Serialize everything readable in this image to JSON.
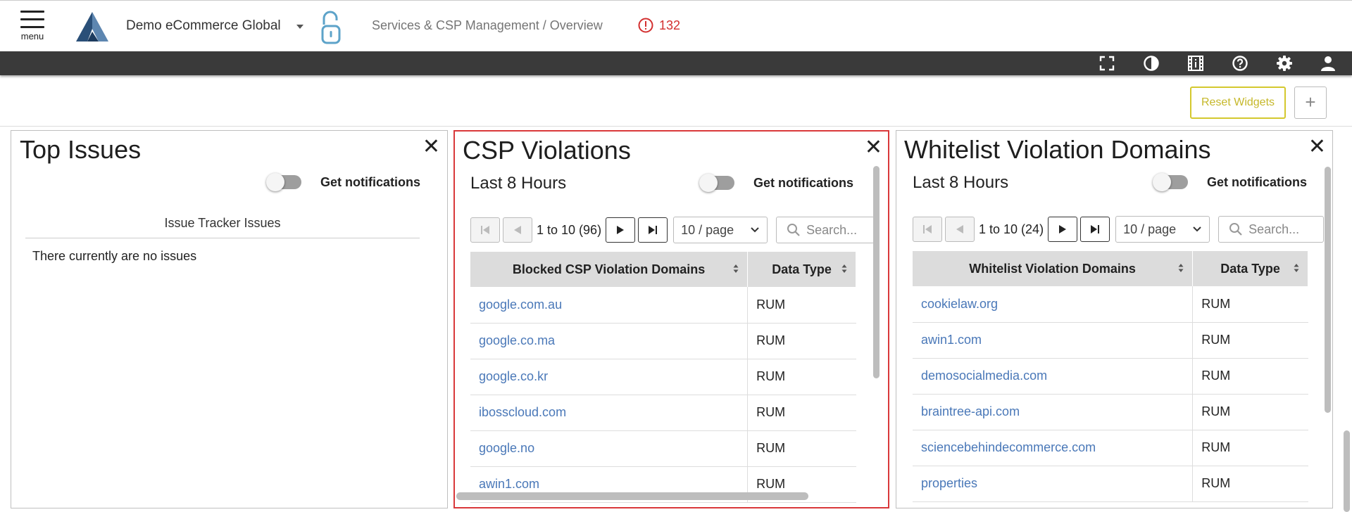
{
  "header": {
    "menu_label": "menu",
    "org_name": "Demo eCommerce Global",
    "breadcrumb": "Services & CSP Management / Overview",
    "alert_count": "132"
  },
  "toolbar": {
    "icons": [
      "fullscreen-icon",
      "contrast-icon",
      "release-notes-icon",
      "help-icon",
      "settings-icon",
      "user-icon"
    ]
  },
  "widgets": {
    "reset_label": "Reset Widgets",
    "add_label": "+"
  },
  "top_issues": {
    "title": "Top Issues",
    "close": "✕",
    "notifications_label": "Get notifications",
    "table_header": "Issue Tracker Issues",
    "empty_text": "There currently are no issues"
  },
  "csp": {
    "title": "CSP Violations",
    "close": "✕",
    "range": "Last 8 Hours",
    "notifications_label": "Get notifications",
    "pager_text": "1 to 10 (96)",
    "per_page": "10 / page",
    "search_placeholder": "Search...",
    "columns": [
      "Blocked CSP Violation Domains",
      "Data Type"
    ],
    "rows": [
      [
        "google.com.au",
        "RUM"
      ],
      [
        "google.co.ma",
        "RUM"
      ],
      [
        "google.co.kr",
        "RUM"
      ],
      [
        "ibosscloud.com",
        "RUM"
      ],
      [
        "google.no",
        "RUM"
      ],
      [
        "awin1.com",
        "RUM"
      ]
    ]
  },
  "whitelist": {
    "title": "Whitelist Violation Domains",
    "close": "✕",
    "range": "Last 8 Hours",
    "notifications_label": "Get notifications",
    "pager_text": "1 to 10 (24)",
    "per_page": "10 / page",
    "search_placeholder": "Search...",
    "columns": [
      "Whitelist Violation Domains",
      "Data Type"
    ],
    "rows": [
      [
        "cookielaw.org",
        "RUM"
      ],
      [
        "awin1.com",
        "RUM"
      ],
      [
        "demosocialmedia.com",
        "RUM"
      ],
      [
        "braintree-api.com",
        "RUM"
      ],
      [
        "sciencebehindecommerce.com",
        "RUM"
      ],
      [
        "properties",
        "RUM"
      ]
    ]
  },
  "colors": {
    "dark_bar": "#3a3a3a",
    "link": "#4a78b8",
    "alert": "#d32f2f",
    "reset_border": "#d4c82e",
    "highlight": "#d9383a"
  }
}
